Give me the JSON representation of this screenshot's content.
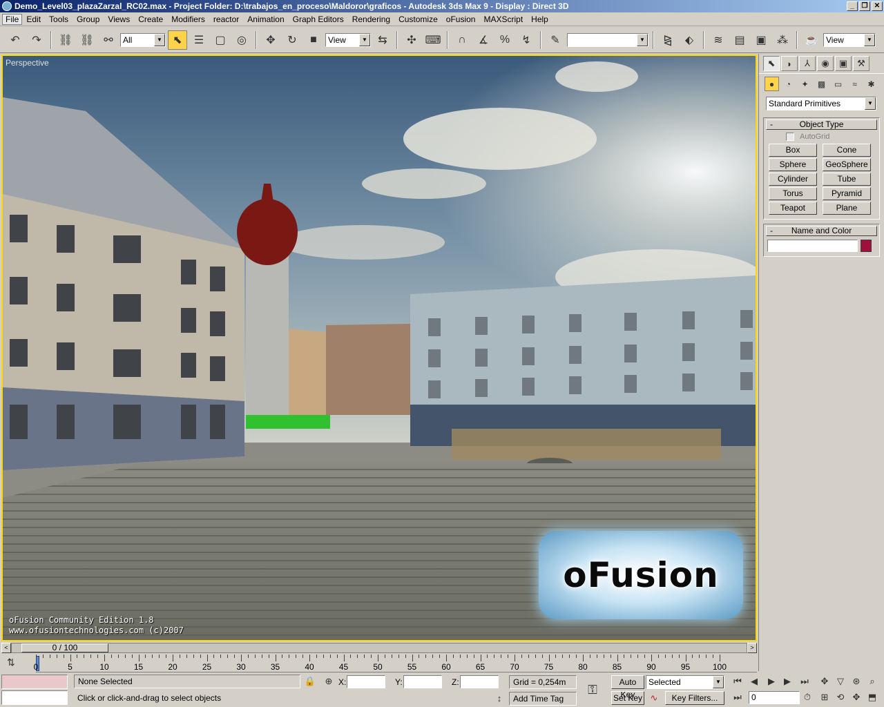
{
  "window": {
    "title": "Demo_Level03_plazaZarzal_RC02.max    - Project Folder: D:\\trabajos_en_proceso\\Maldoror\\graficos    - Autodesk 3ds Max 9     - Display : Direct 3D",
    "minimize": "_",
    "restore": "❐",
    "close": "✕"
  },
  "menu": [
    "File",
    "Edit",
    "Tools",
    "Group",
    "Views",
    "Create",
    "Modifiers",
    "reactor",
    "Animation",
    "Graph Editors",
    "Rendering",
    "Customize",
    "oFusion",
    "MAXScript",
    "Help"
  ],
  "toolbar": {
    "selection_filter": "All",
    "ref_coord_system": "View",
    "named_selection": "",
    "view_dropdown": "View",
    "icons": {
      "undo": "↶",
      "redo": "↷",
      "link": "⛓",
      "unlink": "⛓",
      "bind": "⚯",
      "select": "⬉",
      "select_by_name": "☰",
      "rect_region": "▢",
      "window_crossing": "◎",
      "move": "✥",
      "rotate": "↻",
      "scale": "■",
      "mirror_select": "⇆",
      "manipulate": "✣",
      "keyboard": "⌨",
      "snap": "∩",
      "angle_snap": "∡",
      "percent_snap": "%",
      "spinner_snap": "↯",
      "edit_named": "✎",
      "mirror": "⧎",
      "align": "⬖",
      "layers": "≋",
      "curve_editor": "▤",
      "schematic": "▣",
      "material_editor": "⁂",
      "render_scene": "☕"
    }
  },
  "viewport": {
    "label": "Perspective",
    "watermark_line1": "oFusion  Community  Edition  1.8",
    "watermark_line2": "www.ofusiontechnologies.com  (c)2007",
    "logo_text": "oFusion"
  },
  "command_panel": {
    "tab_icons": [
      "⬉",
      "◗",
      "⅄",
      "◉",
      "▣",
      "⚒"
    ],
    "subtab_icons": [
      "●",
      "◔",
      "✦",
      "▩",
      "▭",
      "≈",
      "✱"
    ],
    "category": "Standard Primitives",
    "object_type_title": "Object Type",
    "autogrid": "AutoGrid",
    "objects": [
      "Box",
      "Cone",
      "Sphere",
      "GeoSphere",
      "Cylinder",
      "Tube",
      "Torus",
      "Pyramid",
      "Teapot",
      "Plane"
    ],
    "name_color_title": "Name and Color",
    "name_value": "",
    "object_color": "#a0103c",
    "minus": "-"
  },
  "time": {
    "slider_label": "0 / 100",
    "prev": "<",
    "next": ">",
    "ticks": [
      "0",
      "5",
      "10",
      "15",
      "20",
      "25",
      "30",
      "35",
      "40",
      "45",
      "50",
      "55",
      "60",
      "65",
      "70",
      "75",
      "80",
      "85",
      "90",
      "95",
      "100"
    ]
  },
  "status": {
    "selection": "None Selected",
    "prompt": "Click or click-and-drag to select objects",
    "x_label": "X:",
    "y_label": "Y:",
    "z_label": "Z:",
    "x_value": "",
    "y_value": "",
    "z_value": "",
    "grid": "Grid = 0,254m",
    "add_time_tag": "Add Time Tag",
    "auto_key": "Auto Key",
    "set_key": "Set Key",
    "key_mode": "Selected",
    "key_filters": "Key Filters...",
    "frame": "0",
    "icons": {
      "lock": "🔒",
      "abs_rel": "⊕",
      "key": "⚿",
      "tangent": "∿",
      "go_start": "⏮",
      "prev_frame": "◀",
      "play": "▶",
      "next_frame": "▶",
      "go_end": "⏭",
      "key_mode_toggle": "⏭",
      "time_config": "⏱",
      "pan": "✥",
      "zoom": "⌕",
      "zoom_all": "⊞",
      "field_of_view": "▽",
      "arc_rotate": "⟲",
      "orbit": "⊛",
      "maximize": "⬒",
      "timeline_config": "⇅",
      "spinner": "↕"
    }
  },
  "colors": {
    "ui_bg": "#d4d0c8",
    "viewport_border": "#ffd800",
    "active_tool": "#ffd44a"
  }
}
